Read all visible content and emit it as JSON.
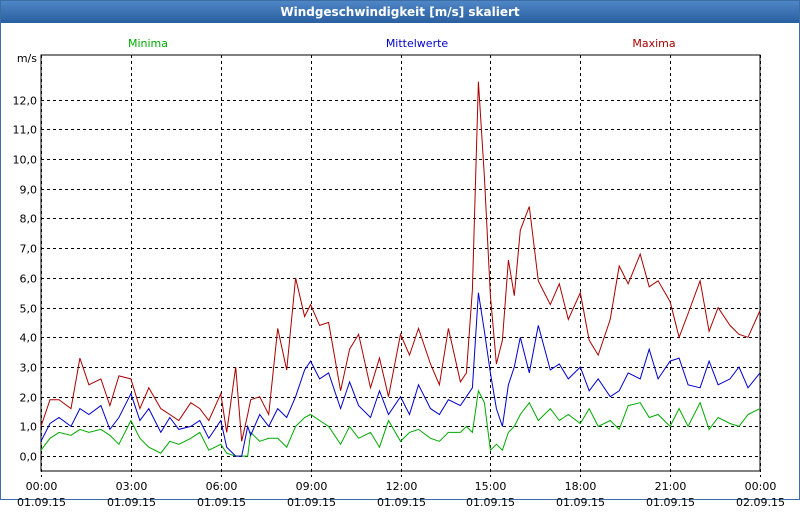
{
  "window": {
    "title": "Windgeschwindigkeit [m/s] skaliert"
  },
  "chart_data": {
    "type": "line",
    "title": "Windgeschwindigkeit [m/s] skaliert",
    "ylabel": "m/s",
    "xlabel": "",
    "ylim": [
      -0.5,
      13.5
    ],
    "xlim": [
      0,
      24
    ],
    "yticks": [
      0,
      1,
      2,
      3,
      4,
      5,
      6,
      7,
      8,
      9,
      10,
      11,
      12
    ],
    "ytick_labels": [
      "0,0",
      "1,0",
      "2,0",
      "3,0",
      "4,0",
      "5,0",
      "6,0",
      "7,0",
      "8,0",
      "9,0",
      "10,0",
      "11,0",
      "12,0"
    ],
    "xticks": [
      {
        "x": 0,
        "time": "00:00",
        "date": "01.09.15"
      },
      {
        "x": 3,
        "time": "03:00",
        "date": "01.09.15"
      },
      {
        "x": 6,
        "time": "06:00",
        "date": "01.09.15"
      },
      {
        "x": 9,
        "time": "09:00",
        "date": "01.09.15"
      },
      {
        "x": 12,
        "time": "12:00",
        "date": "01.09.15"
      },
      {
        "x": 15,
        "time": "15:00",
        "date": "01.09.15"
      },
      {
        "x": 18,
        "time": "18:00",
        "date": "01.09.15"
      },
      {
        "x": 21,
        "time": "21:00",
        "date": "01.09.15"
      },
      {
        "x": 24,
        "time": "00:00",
        "date": "02.09.15"
      }
    ],
    "grid": true,
    "legend_position": "top",
    "series": [
      {
        "name": "Minima",
        "color": "#00aa00",
        "x": [
          0,
          0.3,
          0.6,
          1,
          1.3,
          1.6,
          2,
          2.3,
          2.6,
          3,
          3.3,
          3.6,
          4,
          4.3,
          4.6,
          5,
          5.3,
          5.6,
          6,
          6.2,
          6.5,
          6.7,
          6.9,
          7,
          7.3,
          7.6,
          7.9,
          8.2,
          8.5,
          8.8,
          9,
          9.3,
          9.6,
          10,
          10.3,
          10.6,
          11,
          11.3,
          11.6,
          12,
          12.3,
          12.6,
          13,
          13.3,
          13.6,
          14,
          14.2,
          14.4,
          14.6,
          14.8,
          15,
          15.2,
          15.4,
          15.6,
          15.8,
          16,
          16.3,
          16.6,
          17,
          17.3,
          17.6,
          18,
          18.3,
          18.6,
          19,
          19.3,
          19.6,
          20,
          20.3,
          20.6,
          21,
          21.3,
          21.6,
          22,
          22.3,
          22.6,
          23,
          23.3,
          23.6,
          24
        ],
        "values": [
          0.2,
          0.6,
          0.8,
          0.7,
          0.9,
          0.8,
          0.9,
          0.7,
          0.4,
          1.2,
          0.6,
          0.3,
          0.1,
          0.5,
          0.4,
          0.6,
          0.8,
          0.2,
          0.4,
          0.1,
          0.0,
          0.0,
          0.0,
          0.8,
          0.5,
          0.6,
          0.6,
          0.3,
          1.0,
          1.3,
          1.4,
          1.2,
          1.0,
          0.4,
          1.0,
          0.6,
          0.8,
          0.3,
          1.2,
          0.5,
          0.8,
          0.9,
          0.6,
          0.5,
          0.8,
          0.8,
          1.0,
          0.8,
          2.2,
          1.8,
          0.2,
          0.4,
          0.2,
          0.8,
          1.0,
          1.4,
          1.8,
          1.2,
          1.6,
          1.2,
          1.4,
          1.1,
          1.6,
          1.0,
          1.2,
          0.9,
          1.7,
          1.8,
          1.3,
          1.4,
          1.0,
          1.6,
          1.0,
          1.8,
          0.9,
          1.3,
          1.1,
          1.0,
          1.4,
          1.6
        ]
      },
      {
        "name": "Mittelwerte",
        "color": "#0000cc",
        "x": [
          0,
          0.3,
          0.6,
          1,
          1.3,
          1.6,
          2,
          2.3,
          2.6,
          3,
          3.3,
          3.6,
          4,
          4.3,
          4.6,
          5,
          5.3,
          5.6,
          6,
          6.2,
          6.5,
          6.7,
          6.9,
          7,
          7.3,
          7.6,
          7.9,
          8.2,
          8.5,
          8.8,
          9,
          9.3,
          9.6,
          10,
          10.3,
          10.6,
          11,
          11.3,
          11.6,
          12,
          12.3,
          12.6,
          13,
          13.3,
          13.6,
          14,
          14.2,
          14.4,
          14.6,
          14.8,
          15,
          15.2,
          15.4,
          15.6,
          15.8,
          16,
          16.3,
          16.6,
          17,
          17.3,
          17.6,
          18,
          18.3,
          18.6,
          19,
          19.3,
          19.6,
          20,
          20.3,
          20.6,
          21,
          21.3,
          21.6,
          22,
          22.3,
          22.6,
          23,
          23.3,
          23.6,
          24
        ],
        "values": [
          0.5,
          1.1,
          1.3,
          1.0,
          1.6,
          1.4,
          1.7,
          0.9,
          1.3,
          2.1,
          1.2,
          1.6,
          0.8,
          1.3,
          0.9,
          1.0,
          1.2,
          0.6,
          1.2,
          0.3,
          0.0,
          0.0,
          1.0,
          0.7,
          1.4,
          1.0,
          1.6,
          1.3,
          2.0,
          2.9,
          3.2,
          2.6,
          2.8,
          1.6,
          2.5,
          1.7,
          1.3,
          2.2,
          1.4,
          2.0,
          1.4,
          2.4,
          1.6,
          1.4,
          1.9,
          1.7,
          2.0,
          2.3,
          5.5,
          4.2,
          2.8,
          1.6,
          1.0,
          2.4,
          3.0,
          4.0,
          2.8,
          4.4,
          2.9,
          3.1,
          2.6,
          3.0,
          2.2,
          2.6,
          2.0,
          2.2,
          2.8,
          2.6,
          3.6,
          2.6,
          3.2,
          3.3,
          2.4,
          2.3,
          3.2,
          2.4,
          2.6,
          3.0,
          2.3,
          2.8
        ]
      },
      {
        "name": "Maxima",
        "color": "#aa0000",
        "x": [
          0,
          0.3,
          0.6,
          1,
          1.3,
          1.6,
          2,
          2.3,
          2.6,
          3,
          3.3,
          3.6,
          4,
          4.3,
          4.6,
          5,
          5.3,
          5.6,
          6,
          6.2,
          6.5,
          6.7,
          6.9,
          7,
          7.3,
          7.6,
          7.9,
          8.2,
          8.5,
          8.8,
          9,
          9.3,
          9.6,
          10,
          10.3,
          10.6,
          11,
          11.3,
          11.6,
          12,
          12.3,
          12.6,
          13,
          13.3,
          13.6,
          14,
          14.2,
          14.4,
          14.6,
          14.8,
          15,
          15.2,
          15.4,
          15.6,
          15.8,
          16,
          16.3,
          16.6,
          17,
          17.3,
          17.6,
          18,
          18.3,
          18.6,
          19,
          19.3,
          19.6,
          20,
          20.3,
          20.6,
          21,
          21.3,
          21.6,
          22,
          22.3,
          22.6,
          23,
          23.3,
          23.6,
          24
        ],
        "values": [
          1.0,
          1.9,
          1.9,
          1.6,
          3.3,
          2.4,
          2.6,
          1.7,
          2.7,
          2.6,
          1.6,
          2.3,
          1.6,
          1.4,
          1.2,
          1.8,
          1.6,
          1.2,
          2.1,
          0.8,
          3.0,
          0.5,
          1.4,
          1.9,
          2.0,
          1.4,
          4.3,
          2.9,
          6.0,
          4.7,
          5.1,
          4.4,
          4.5,
          2.2,
          3.6,
          4.1,
          2.3,
          3.3,
          2.0,
          4.1,
          3.4,
          4.3,
          3.1,
          2.4,
          4.3,
          2.5,
          2.8,
          5.6,
          12.6,
          9.4,
          5.4,
          3.1,
          3.9,
          6.6,
          5.4,
          7.6,
          8.4,
          5.9,
          5.1,
          5.8,
          4.6,
          5.5,
          3.9,
          3.4,
          4.6,
          6.4,
          5.8,
          6.8,
          5.7,
          5.9,
          5.2,
          4.0,
          4.8,
          5.9,
          4.2,
          5.0,
          4.4,
          4.1,
          4.0,
          4.9
        ]
      }
    ]
  }
}
